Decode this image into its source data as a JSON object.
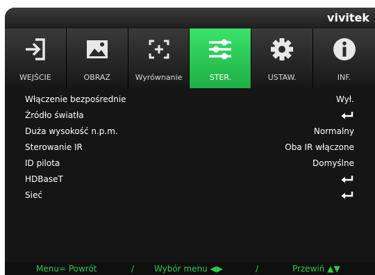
{
  "brand": "vivitek",
  "tabs": [
    {
      "label": "WEJŚCIE",
      "icon": "input-arrow-icon",
      "active": false
    },
    {
      "label": "OBRAZ",
      "icon": "image-icon",
      "active": false
    },
    {
      "label": "Wyrównanie",
      "icon": "alignment-icon",
      "active": false
    },
    {
      "label": "STER.",
      "icon": "sliders-icon",
      "active": true
    },
    {
      "label": "USTAW.",
      "icon": "gear-icon",
      "active": false
    },
    {
      "label": "INF.",
      "icon": "info-icon",
      "active": false
    }
  ],
  "menu": [
    {
      "label": "Włączenie bezpośrednie",
      "value": "Wył."
    },
    {
      "label": "Źródło światła",
      "value": "",
      "enter": true
    },
    {
      "label": "Duża wysokość n.p.m.",
      "value": "Normalny"
    },
    {
      "label": "Sterowanie IR",
      "value": "Oba IR włączone"
    },
    {
      "label": "ID pilota",
      "value": "Domyślne"
    },
    {
      "label": "HDBaseT",
      "value": "",
      "enter": true
    },
    {
      "label": "Sieć",
      "value": "",
      "enter": true
    }
  ],
  "footer": {
    "menu_back": "Menu= Powrót",
    "sep1": "/",
    "select": "Wybór menu ◀▶",
    "sep2": "/",
    "scroll": "Przewiń ▲▼"
  },
  "colors": {
    "active_tab": "#2ec955",
    "footer_text": "#2fc84c",
    "background": "#151515"
  }
}
